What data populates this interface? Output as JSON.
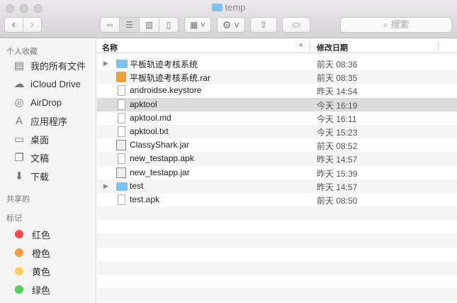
{
  "window": {
    "title": "temp"
  },
  "toolbar": {
    "search_placeholder": "搜索"
  },
  "sidebar": {
    "favorites_label": "个人收藏",
    "favorites": [
      {
        "label": "我的所有文件",
        "icon": "all-files-icon"
      },
      {
        "label": "iCloud Drive",
        "icon": "cloud-icon"
      },
      {
        "label": "AirDrop",
        "icon": "airdrop-icon"
      },
      {
        "label": "应用程序",
        "icon": "applications-icon"
      },
      {
        "label": "桌面",
        "icon": "desktop-icon"
      },
      {
        "label": "文稿",
        "icon": "documents-icon"
      },
      {
        "label": "下载",
        "icon": "download-icon"
      }
    ],
    "shared_label": "共享的",
    "tags_label": "标记",
    "tags": [
      {
        "label": "红色",
        "color": "#fc4b4b"
      },
      {
        "label": "橙色",
        "color": "#fd9a42"
      },
      {
        "label": "黄色",
        "color": "#fcd15a"
      },
      {
        "label": "绿色",
        "color": "#4fd15a"
      }
    ]
  },
  "columns": {
    "name": "名称",
    "date": "修改日期"
  },
  "files": [
    {
      "name": "平板轨迹考核系统",
      "date": "前天 08:36",
      "type": "folder"
    },
    {
      "name": "平板轨迹考核系统.rar",
      "date": "前天 08:35",
      "type": "rar"
    },
    {
      "name": "androidse.keystore",
      "date": "昨天 14:54",
      "type": "doc"
    },
    {
      "name": "apktool",
      "date": "今天 16:19",
      "type": "doc"
    },
    {
      "name": "apktool.md",
      "date": "今天 16:11",
      "type": "doc"
    },
    {
      "name": "apktool.txt",
      "date": "今天 15:23",
      "type": "doc"
    },
    {
      "name": "ClassyShark.jar",
      "date": "前天 08:52",
      "type": "jar"
    },
    {
      "name": "new_testapp.apk",
      "date": "昨天 14:57",
      "type": "doc"
    },
    {
      "name": "new_testapp.jar",
      "date": "昨天 15:39",
      "type": "jar"
    },
    {
      "name": "test",
      "date": "昨天 14:57",
      "type": "folder"
    },
    {
      "name": "test.apk",
      "date": "前天 08:50",
      "type": "doc"
    }
  ],
  "selected_index": 3
}
